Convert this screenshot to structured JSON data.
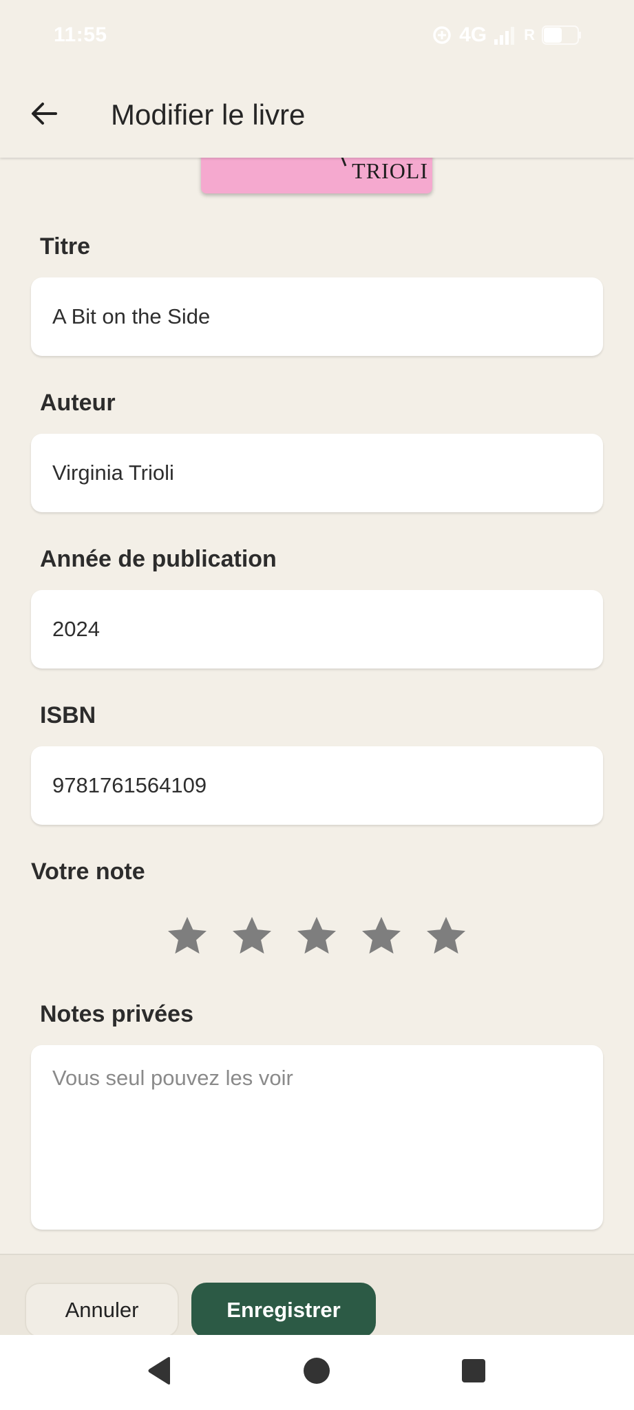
{
  "status_bar": {
    "time": "11:55",
    "network": "4G",
    "roaming": "R"
  },
  "app_bar": {
    "title": "Modifier le livre",
    "back_icon": "arrow-left-icon"
  },
  "cover": {
    "text": "TRIOLI",
    "color": "#f5a9cf"
  },
  "form": {
    "title": {
      "label": "Titre",
      "value": "A Bit on the Side"
    },
    "author": {
      "label": "Auteur",
      "value": "Virginia Trioli"
    },
    "year": {
      "label": "Année de publication",
      "value": "2024"
    },
    "isbn": {
      "label": "ISBN",
      "value": "9781761564109"
    },
    "rating": {
      "label": "Votre note",
      "value": 0,
      "max": 5
    },
    "notes": {
      "label": "Notes privées",
      "value": "",
      "placeholder": "Vous seul pouvez les voir"
    }
  },
  "actions": {
    "cancel": "Annuler",
    "save": "Enregistrer"
  },
  "colors": {
    "background": "#f3efe7",
    "accent": "#2c5a45",
    "star_inactive": "#7e7e7e"
  }
}
